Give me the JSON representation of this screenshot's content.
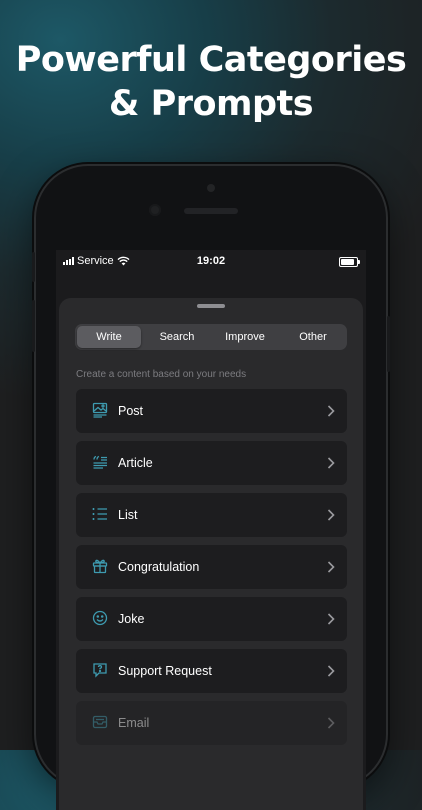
{
  "headline": {
    "line1": "Powerful Categories",
    "line2": "& Prompts"
  },
  "status_bar": {
    "carrier": "Service",
    "time": "19:02"
  },
  "tabs": [
    {
      "label": "Write",
      "active": true
    },
    {
      "label": "Search",
      "active": false
    },
    {
      "label": "Improve",
      "active": false
    },
    {
      "label": "Other",
      "active": false
    }
  ],
  "subtitle": "Create a content based on your needs",
  "items": [
    {
      "label": "Post",
      "icon": "image-icon"
    },
    {
      "label": "Article",
      "icon": "quote-text-icon"
    },
    {
      "label": "List",
      "icon": "list-icon"
    },
    {
      "label": "Congratulation",
      "icon": "gift-icon"
    },
    {
      "label": "Joke",
      "icon": "smile-icon"
    },
    {
      "label": "Support Request",
      "icon": "help-chat-icon"
    },
    {
      "label": "Email",
      "icon": "inbox-icon"
    }
  ],
  "colors": {
    "accent": "#3e9bb0",
    "sheet": "#2a2a2c",
    "row": "#1d1d1f"
  }
}
